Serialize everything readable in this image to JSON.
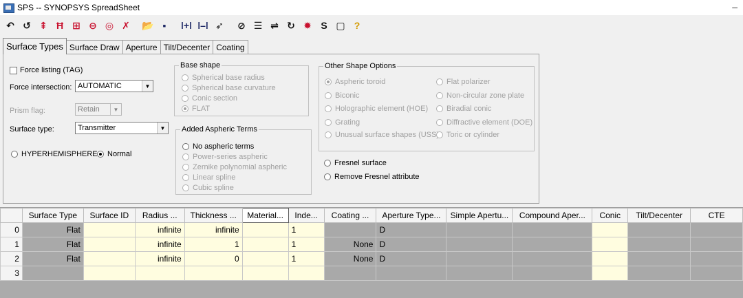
{
  "window": {
    "title": "SPS -- SYNOPSYS SpreadSheet",
    "minimize": "–"
  },
  "toolbar": {
    "buttons": [
      {
        "name": "undo-all-icon",
        "glyph": "↶",
        "color": "#111111"
      },
      {
        "name": "undo-icon",
        "glyph": "↺",
        "color": "#111111"
      },
      {
        "name": "insert-surface-icon",
        "glyph": "⇞",
        "color": "#c8102e"
      },
      {
        "name": "h-bar-icon",
        "glyph": "Ħ",
        "color": "#c8102e"
      },
      {
        "name": "grid-red-icon",
        "glyph": "⊞",
        "color": "#c8102e"
      },
      {
        "name": "circle-line-icon",
        "glyph": "⊖",
        "color": "#c8102e"
      },
      {
        "name": "target-icon",
        "glyph": "◎",
        "color": "#c8102e"
      },
      {
        "name": "delete-icon",
        "glyph": "✗",
        "color": "#c8102e"
      },
      {
        "name": "open-folder-icon",
        "glyph": "📂",
        "color": "#d39a00"
      },
      {
        "name": "save-icon",
        "glyph": "▪",
        "color": "#1f2a66"
      },
      {
        "name": "bar-insert-icon",
        "glyph": "ǀ+ǀ",
        "color": "#1f2a66"
      },
      {
        "name": "bar-icon",
        "glyph": "ǀ–ǀ",
        "color": "#1f2a66"
      },
      {
        "name": "pointer-icon",
        "glyph": "➶",
        "color": "#111111"
      },
      {
        "name": "no-icon",
        "glyph": "⊘",
        "color": "#111111"
      },
      {
        "name": "list-icon",
        "glyph": "☰",
        "color": "#111111"
      },
      {
        "name": "adjust-icon",
        "glyph": "⇌",
        "color": "#111111"
      },
      {
        "name": "refresh-icon",
        "glyph": "↻",
        "color": "#111111"
      },
      {
        "name": "gear-stop-icon",
        "glyph": "✹",
        "color": "#c8102e"
      },
      {
        "name": "s-icon",
        "glyph": "S",
        "color": "#111111"
      },
      {
        "name": "window-icon",
        "glyph": "▢",
        "color": "#111111"
      },
      {
        "name": "help-icon",
        "glyph": "?",
        "color": "#d39a00"
      }
    ]
  },
  "tabs": [
    "Surface Types",
    "Surface Draw",
    "Aperture",
    "Tilt/Decenter",
    "Coating"
  ],
  "panel": {
    "force_listing": "Force listing (TAG)",
    "force_intersection_label": "Force intersection:",
    "force_intersection_value": "AUTOMATIC",
    "prism_flag_label": "Prism flag:",
    "prism_flag_value": "Retain",
    "surface_type_label": "Surface type:",
    "surface_type_value": "Transmitter",
    "hyperhemisphere": "HYPERHEMISPHERE",
    "normal": "Normal",
    "base_shape": {
      "title": "Base shape",
      "options": [
        "Spherical base radius",
        "Spherical base curvature",
        "Conic section",
        "FLAT"
      ]
    },
    "aspheric": {
      "title": "Added Aspheric Terms",
      "options": [
        "No aspheric terms",
        "Power-series aspheric",
        "Zernike polynomial aspheric",
        "Linear spline",
        "Cubic spline"
      ]
    },
    "other_shape": {
      "title": "Other Shape Options",
      "left": [
        "Aspheric toroid",
        "Biconic",
        "Holographic element (HOE)",
        "Grating",
        "Unusual surface shapes (USS)"
      ],
      "right": [
        "Flat polarizer",
        "Non-circular zone plate",
        "Biradial conic",
        "Diffractive element (DOE)",
        "Toric or cylinder"
      ]
    },
    "fresnel_surface": "Fresnel surface",
    "remove_fresnel": "Remove Fresnel attribute"
  },
  "grid": {
    "columns": [
      "Surface Type",
      "Surface ID",
      "Radius ...",
      "Thickness ...",
      "Material...",
      "Inde...",
      "Coating ...",
      "Aperture Type...",
      "Simple Apertu...",
      "Compound Aper...",
      "Conic",
      "Tilt/Decenter",
      "CTE"
    ],
    "rows": [
      {
        "n": "0",
        "cells": [
          "Flat",
          "",
          "infinite",
          "infinite",
          "",
          "1",
          "",
          "D",
          "",
          "",
          "",
          "",
          ""
        ]
      },
      {
        "n": "1",
        "cells": [
          "Flat",
          "",
          "infinite",
          "1",
          "",
          "1",
          "None",
          "D",
          "",
          "",
          "",
          "",
          ""
        ]
      },
      {
        "n": "2",
        "cells": [
          "Flat",
          "",
          "infinite",
          "0",
          "",
          "1",
          "None",
          "D",
          "",
          "",
          "",
          "",
          ""
        ]
      },
      {
        "n": "3",
        "cells": [
          "",
          "",
          "",
          "",
          "",
          "",
          "",
          "",
          "",
          "",
          "",
          "",
          ""
        ]
      }
    ]
  }
}
